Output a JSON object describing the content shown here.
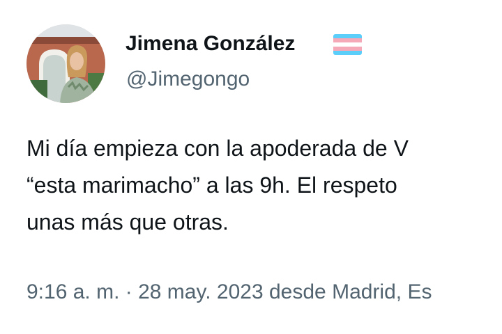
{
  "author": {
    "name": "Jimena González",
    "handle": "@Jimegongo",
    "badge_icon": "transgender-flag-icon",
    "flag_colors": [
      "#5BCEFA",
      "#F5A9B8",
      "#FFFFFF",
      "#F5A9B8",
      "#5BCEFA"
    ]
  },
  "tweet": {
    "lines": [
      "Mi día empieza con la apoderada de V",
      "“esta marimacho” a las 9h. El respeto",
      "unas más que otras."
    ]
  },
  "meta": {
    "time": "9:16 a. m.",
    "separator": "·",
    "date": "28 may. 2023",
    "location": "desde Madrid, Es"
  },
  "colors": {
    "text": "#0f1419",
    "secondary": "#536471",
    "background": "#ffffff"
  }
}
